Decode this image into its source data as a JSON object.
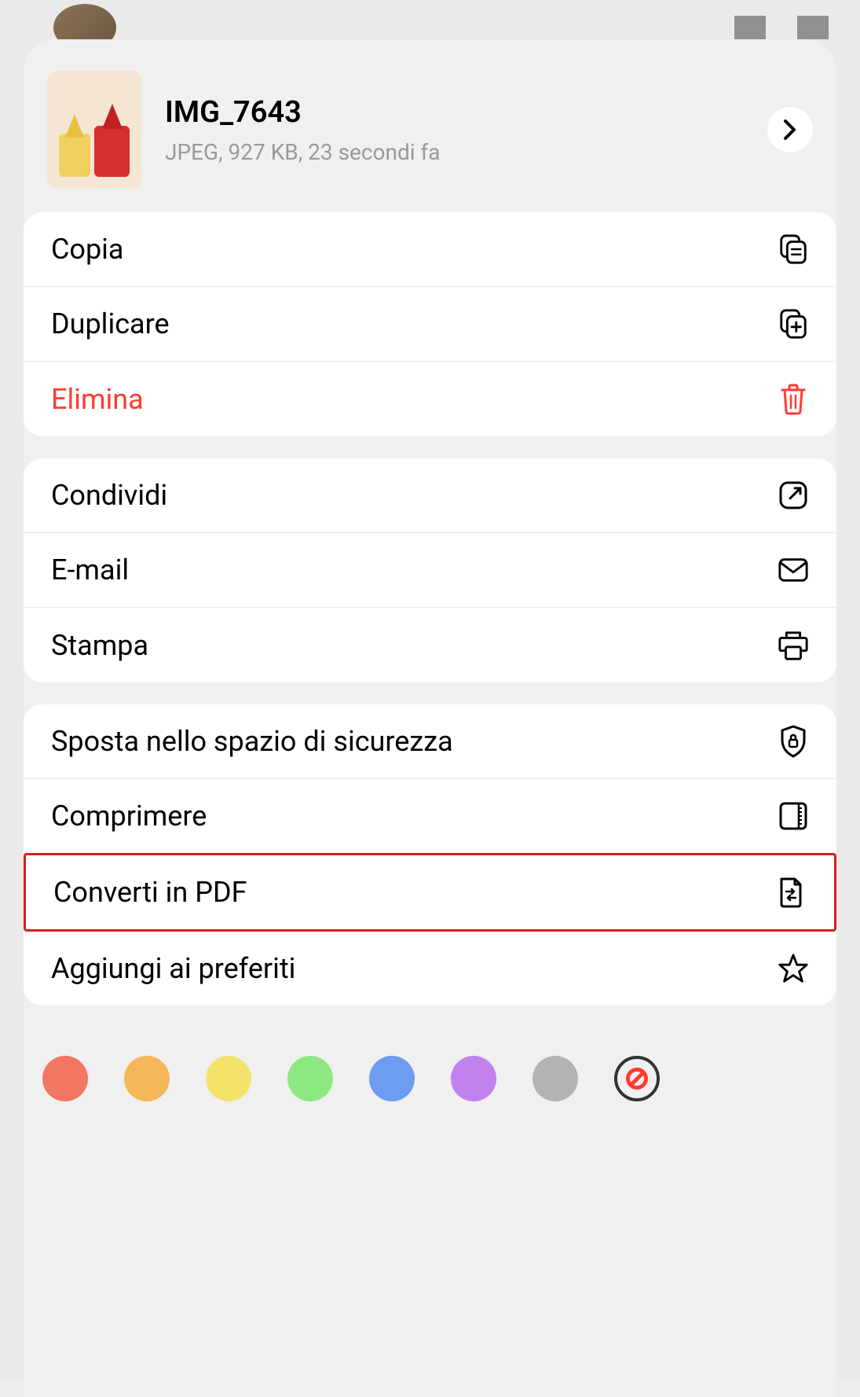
{
  "file": {
    "name": "IMG_7643",
    "meta": "JPEG, 927 KB, 23 secondi fa"
  },
  "sections": {
    "primary": {
      "copy": "Copia",
      "duplicate": "Duplicare",
      "delete": "Elimina"
    },
    "share": {
      "share": "Condividi",
      "email": "E-mail",
      "print": "Stampa"
    },
    "actions": {
      "move_secure": "Sposta nello spazio di sicurezza",
      "compress": "Comprimere",
      "convert_pdf": "Converti in PDF",
      "favorite": "Aggiungi ai preferiti"
    }
  },
  "colors": {
    "red": "#f27662",
    "orange": "#f5b758",
    "yellow": "#f4e36b",
    "green": "#8de882",
    "blue": "#6d9cf0",
    "purple": "#c282ed",
    "gray": "#b3b3b3"
  }
}
